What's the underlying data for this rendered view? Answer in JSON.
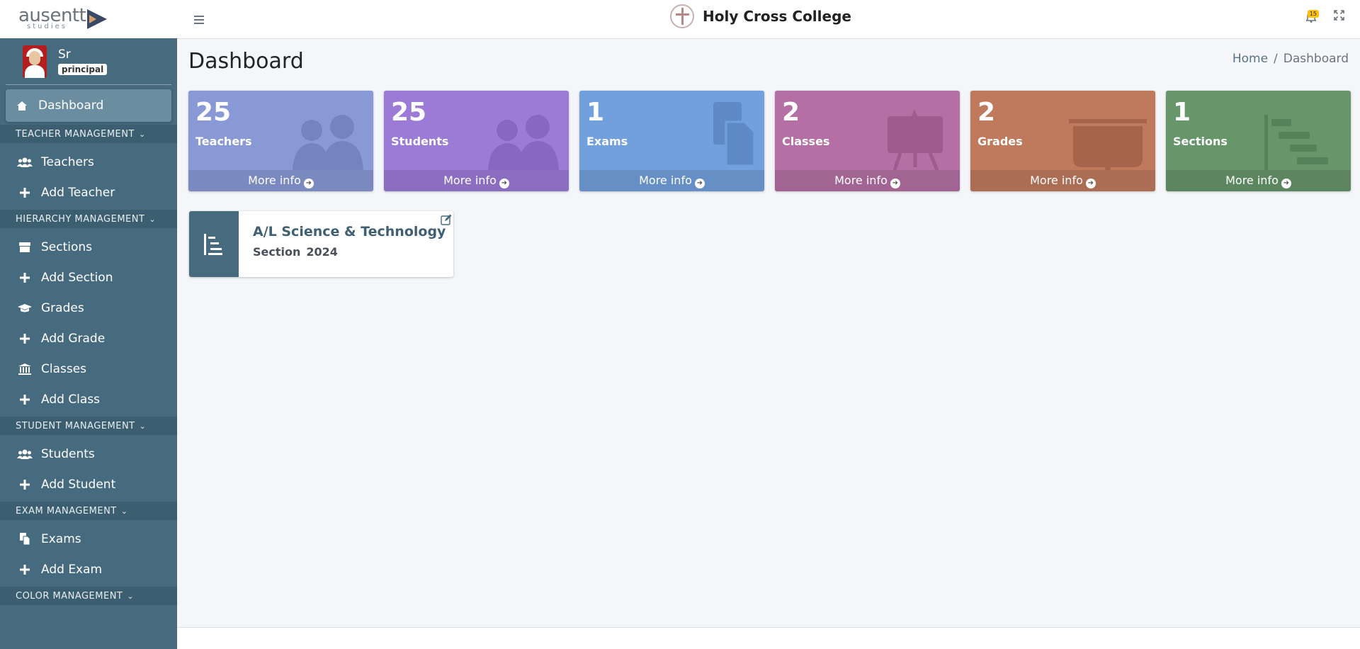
{
  "brand": {
    "word": "ausentt",
    "sub": "studies"
  },
  "user": {
    "name": "Sr",
    "role": "principal"
  },
  "nav": {
    "dashboard": "Dashboard",
    "teacher_header": "TEACHER MANAGEMENT",
    "teachers": "Teachers",
    "add_teacher": "Add Teacher",
    "hierarchy_header": "HIERARCHY MANAGEMENT",
    "sections": "Sections",
    "add_section": "Add Section",
    "grades": "Grades",
    "add_grade": "Add Grade",
    "classes": "Classes",
    "add_class": "Add Class",
    "student_header": "STUDENT MANAGEMENT",
    "students": "Students",
    "add_student": "Add Student",
    "exam_header": "EXAM MANAGEMENT",
    "exams": "Exams",
    "add_exam": "Add Exam",
    "color_header": "COLOR MANAGEMENT"
  },
  "topbar": {
    "college_name": "Holy Cross College",
    "notifications": "15"
  },
  "page": {
    "title": "Dashboard"
  },
  "breadcrumb": {
    "home": "Home",
    "current": "Dashboard"
  },
  "stats": [
    {
      "value": "25",
      "label": "Teachers",
      "more": "More info",
      "color": "#8899d6",
      "icon": "users-icon"
    },
    {
      "value": "25",
      "label": "Students",
      "more": "More info",
      "color": "#9b7bd6",
      "icon": "users-icon"
    },
    {
      "value": "1",
      "label": "Exams",
      "more": "More info",
      "color": "#72a0dd",
      "icon": "copy-icon"
    },
    {
      "value": "2",
      "label": "Classes",
      "more": "More info",
      "color": "#b470a4",
      "icon": "easel-icon"
    },
    {
      "value": "2",
      "label": "Grades",
      "more": "More info",
      "color": "#bf7a5d",
      "icon": "projector-icon"
    },
    {
      "value": "1",
      "label": "Sections",
      "more": "More info",
      "color": "#66966a",
      "icon": "gantt-icon"
    }
  ],
  "section_card": {
    "title": "A/L Science & Technology",
    "label": "Section",
    "year": "2024"
  }
}
